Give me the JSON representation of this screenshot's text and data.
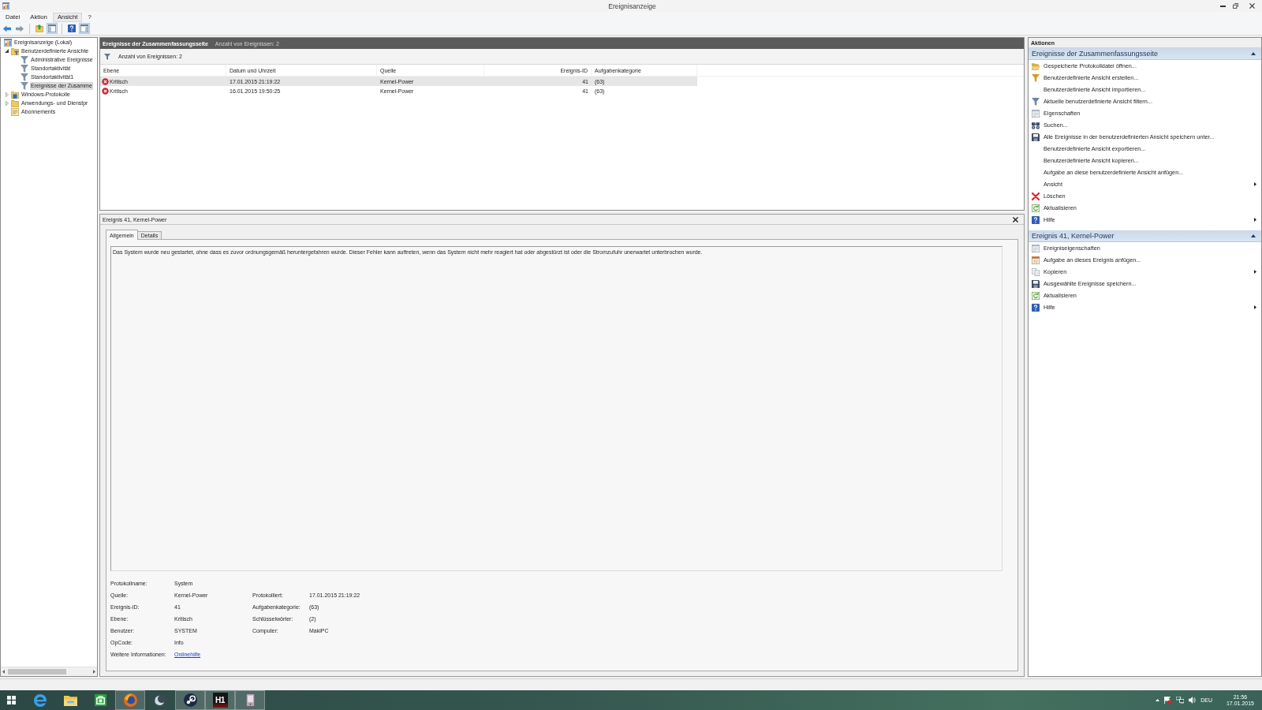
{
  "window": {
    "title": "Ereignisanzeige"
  },
  "menu": [
    {
      "label": "Datei",
      "selected": false
    },
    {
      "label": "Aktion",
      "selected": false
    },
    {
      "label": "Ansicht",
      "selected": true
    },
    {
      "label": "?",
      "selected": false
    }
  ],
  "toolbar": [
    {
      "kind": "back",
      "pressed": false
    },
    {
      "kind": "forward",
      "pressed": false
    },
    {
      "kind": "up",
      "pressed": false
    },
    {
      "kind": "tree-pane",
      "pressed": true
    },
    {
      "kind": "help",
      "pressed": false
    },
    {
      "kind": "action-pane",
      "pressed": true
    }
  ],
  "tree": [
    {
      "label": "Ereignisanzeige (Lokal)",
      "kind": "root",
      "selected": false,
      "children": [
        {
          "label": "Benutzerdefinierte Ansichte",
          "kind": "custom-folder",
          "expanded": true,
          "selected": false,
          "children": [
            {
              "label": "Administrative Ereignisse",
              "kind": "view",
              "selected": false
            },
            {
              "label": "Standortaktivität",
              "kind": "view",
              "selected": false
            },
            {
              "label": "Standortaktivität1",
              "kind": "view",
              "selected": false
            },
            {
              "label": "Ereignisse der Zusamme",
              "kind": "view",
              "selected": true
            }
          ]
        },
        {
          "label": "Windows-Protokolle",
          "kind": "logs",
          "expanded": false,
          "selected": false
        },
        {
          "label": "Anwendungs- und Dienstpr",
          "kind": "folder",
          "expanded": false,
          "selected": false
        },
        {
          "label": "Abonnements",
          "kind": "subscriptions",
          "selected": false
        }
      ]
    }
  ],
  "results": {
    "title": "Ereignisse der Zusammenfassungsseite",
    "subtitle": "Anzahl von Ereignissen: 2",
    "filter_label": "Anzahl von Ereignissen: 2",
    "columns": [
      "Ebene",
      "Datum und Uhrzeit",
      "Quelle",
      "Ereignis-ID",
      "Aufgabenkategorie"
    ],
    "rows": [
      {
        "selected": true,
        "kind": "critical",
        "cells": [
          "Kritisch",
          "17.01.2015 21:19:22",
          "Kernel-Power",
          "41",
          "(63)"
        ]
      },
      {
        "selected": false,
        "kind": "critical",
        "cells": [
          "Kritisch",
          "16.01.2015 19:50:25",
          "Kernel-Power",
          "41",
          "(63)"
        ]
      }
    ]
  },
  "detail": {
    "title": "Ereignis 41, Kernel-Power",
    "tabs": [
      {
        "label": "Allgemein",
        "selected": true
      },
      {
        "label": "Details",
        "selected": false
      }
    ],
    "description": "Das System wurde neu gestartet, ohne dass es zuvor ordnungsgemäß heruntergefahren wurde. Dieser Fehler kann auftreten, wenn das System nicht mehr reagiert hat oder abgestürzt ist oder die Stromzufuhr unerwartet unterbrochen wurde.",
    "field_rows": [
      [
        {
          "label": "Protokollname:",
          "value": "System",
          "kind": "text"
        }
      ],
      [
        {
          "label": "Quelle:",
          "value": "Kernel-Power",
          "kind": "text"
        },
        {
          "label": "Protokolliert:",
          "value": "17.01.2015 21:19:22",
          "kind": "text"
        }
      ],
      [
        {
          "label": "Ereignis-ID:",
          "value": "41",
          "kind": "text"
        },
        {
          "label": "Aufgabenkategorie:",
          "value": "(63)",
          "kind": "text"
        }
      ],
      [
        {
          "label": "Ebene:",
          "value": "Kritisch",
          "kind": "text"
        },
        {
          "label": "Schlüsselwörter:",
          "value": "(2)",
          "kind": "text"
        }
      ],
      [
        {
          "label": "Benutzer:",
          "value": "SYSTEM",
          "kind": "text"
        },
        {
          "label": "Computer:",
          "value": "MakiPC",
          "kind": "text"
        }
      ],
      [
        {
          "label": "OpCode:",
          "value": "Info",
          "kind": "text"
        }
      ],
      [
        {
          "label": "Weitere Informationen:",
          "value": "Onlinehilfe",
          "kind": "link"
        }
      ]
    ]
  },
  "actions": {
    "title": "Aktionen",
    "sections": [
      {
        "title": "Ereignisse der Zusammenfassungsseite",
        "expanded": true,
        "items": [
          {
            "label": "Gespeicherte Protokolldatei öffnen...",
            "kind": "open",
            "submenu": false
          },
          {
            "label": "Benutzerdefinierte Ansicht erstellen...",
            "kind": "create",
            "submenu": false
          },
          {
            "label": "Benutzerdefinierte Ansicht importieren...",
            "kind": "plain",
            "submenu": false
          },
          {
            "label": "Aktuelle benutzerdefinierte Ansicht filtern...",
            "kind": "filter",
            "submenu": false
          },
          {
            "label": "Eigenschaften",
            "kind": "properties",
            "submenu": false
          },
          {
            "label": "Suchen...",
            "kind": "find",
            "submenu": false
          },
          {
            "label": "Alle Ereignisse in der benutzerdefinierten Ansicht speichern unter...",
            "kind": "save",
            "submenu": false
          },
          {
            "label": "Benutzerdefinierte Ansicht exportieren...",
            "kind": "plain",
            "submenu": false
          },
          {
            "label": "Benutzerdefinierte Ansicht kopieren...",
            "kind": "plain",
            "submenu": false
          },
          {
            "label": "Aufgabe an diese benutzerdefinierte Ansicht anfügen...",
            "kind": "plain",
            "submenu": false
          },
          {
            "label": "Ansicht",
            "kind": "plain",
            "submenu": true
          },
          {
            "label": "Löschen",
            "kind": "delete",
            "submenu": false
          },
          {
            "label": "Aktualisieren",
            "kind": "refresh",
            "submenu": false
          },
          {
            "label": "Hilfe",
            "kind": "help",
            "submenu": true
          }
        ]
      },
      {
        "title": "Ereignis 41, Kernel-Power",
        "expanded": true,
        "items": [
          {
            "label": "Ereigniseigenschaften",
            "kind": "properties",
            "submenu": false
          },
          {
            "label": "Aufgabe an dieses Ereignis anfügen...",
            "kind": "task",
            "submenu": false
          },
          {
            "label": "Kopieren",
            "kind": "copy",
            "submenu": true
          },
          {
            "label": "Ausgewählte Ereignisse speichern...",
            "kind": "save",
            "submenu": false
          },
          {
            "label": "Aktualisieren",
            "kind": "refresh",
            "submenu": false
          },
          {
            "label": "Hilfe",
            "kind": "help",
            "submenu": true
          }
        ]
      }
    ]
  },
  "taskbar": {
    "apps": [
      {
        "kind": "browser",
        "running": false
      },
      {
        "kind": "files",
        "running": false
      },
      {
        "kind": "store",
        "running": false
      },
      {
        "kind": "globe",
        "running": true
      },
      {
        "kind": "crescent",
        "running": false
      },
      {
        "kind": "disc",
        "running": true
      },
      {
        "kind": "text-tile",
        "label": "H1",
        "running": true
      },
      {
        "kind": "device",
        "running": true
      }
    ],
    "tray": {
      "language": "DEU",
      "time": "21:56",
      "date": "17.01.2015"
    }
  }
}
